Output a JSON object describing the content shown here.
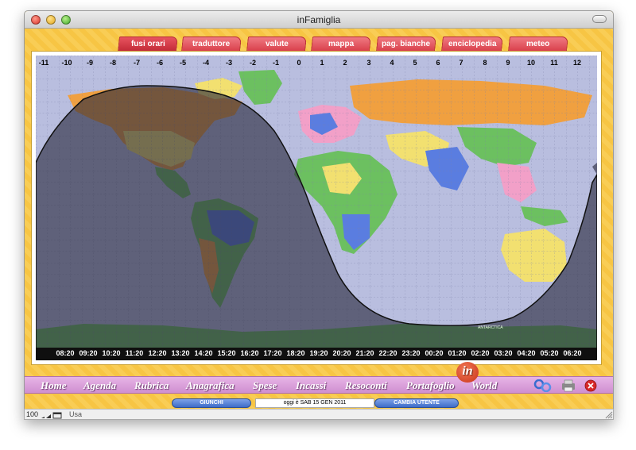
{
  "window": {
    "title": "inFamiglia"
  },
  "tabs": [
    {
      "label": "fusi orari",
      "active": true
    },
    {
      "label": "traduttore",
      "active": false
    },
    {
      "label": "valute",
      "active": false
    },
    {
      "label": "mappa",
      "active": false
    },
    {
      "label": "pag. bianche",
      "active": false
    },
    {
      "label": "enciclopedia",
      "active": false
    },
    {
      "label": "meteo",
      "active": false
    }
  ],
  "map": {
    "timezones": [
      "-11",
      "-10",
      "-9",
      "-8",
      "-7",
      "-6",
      "-5",
      "-4",
      "-3",
      "-2",
      "-1",
      "0",
      "1",
      "2",
      "3",
      "4",
      "5",
      "6",
      "7",
      "8",
      "9",
      "10",
      "11",
      "12"
    ],
    "times": [
      "08:20",
      "09:20",
      "10:20",
      "11:20",
      "12:20",
      "13:20",
      "14:20",
      "15:20",
      "16:20",
      "17:20",
      "18:20",
      "19:20",
      "20:20",
      "21:20",
      "22:20",
      "23:20",
      "00:20",
      "01:20",
      "02:20",
      "03:20",
      "04:20",
      "05:20",
      "06:20"
    ],
    "region_label": "ANTARCTICA",
    "colors": {
      "ocean": "#b9bedf",
      "night": "rgba(40,40,60,0.62)",
      "orange": "#f0a040",
      "green": "#6cc060",
      "blue": "#5a7de0",
      "yellow": "#f2e070",
      "pink": "#f2a0c8"
    }
  },
  "nav": {
    "items": [
      "Home",
      "Agenda",
      "Rubrica",
      "Anagrafica",
      "Spese",
      "Incassi",
      "Resoconti",
      "Portafoglio",
      "World"
    ],
    "logo": "in"
  },
  "status": {
    "user_button": "GIUNCHI",
    "date_text": "oggi è    SAB 15 GEN 2011",
    "change_user": "CAMBIA UTENTE"
  },
  "bottom": {
    "zoom": "100",
    "mode": "Usa"
  }
}
